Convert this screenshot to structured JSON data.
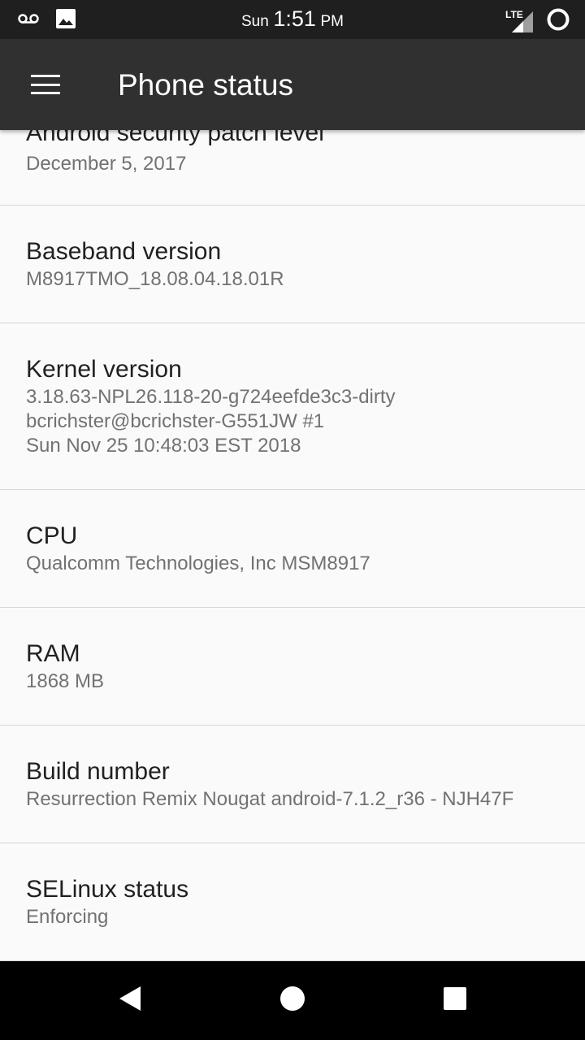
{
  "status_bar": {
    "day": "Sun",
    "time": "1:51",
    "ampm": "PM",
    "network": "LTE",
    "icons_left": [
      "voicemail-icon",
      "image-icon"
    ],
    "icons_right": [
      "lte-signal-icon",
      "battery-ring-icon"
    ]
  },
  "app_bar": {
    "title": "Phone status",
    "menu_icon": "hamburger-menu-icon"
  },
  "items": [
    {
      "title": "Android security patch level",
      "summary": "December 5, 2017"
    },
    {
      "title": "Baseband version",
      "summary": "M8917TMO_18.08.04.18.01R"
    },
    {
      "title": "Kernel version",
      "summary": "3.18.63-NPL26.118-20-g724eefde3c3-dirty\nbcrichster@bcrichster-G551JW #1\nSun Nov 25 10:48:03 EST 2018"
    },
    {
      "title": "CPU",
      "summary": "Qualcomm Technologies, Inc MSM8917"
    },
    {
      "title": "RAM",
      "summary": "1868 MB"
    },
    {
      "title": "Build number",
      "summary": "Resurrection Remix Nougat android-7.1.2_r36 - NJH47F"
    },
    {
      "title": "SELinux status",
      "summary": "Enforcing"
    }
  ],
  "nav_bar": {
    "icons": [
      "back-icon",
      "home-icon",
      "recents-icon"
    ]
  }
}
